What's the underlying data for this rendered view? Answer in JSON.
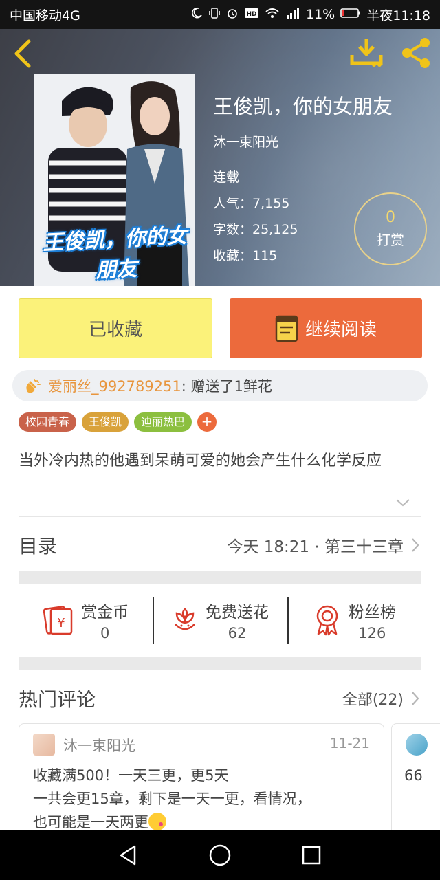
{
  "status_bar": {
    "carrier": "中国移动4G",
    "battery": "11%",
    "time": "半夜11:18",
    "icons": [
      "moon-icon",
      "vibrate-icon",
      "alarm-icon",
      "hd-icon",
      "wifi-icon",
      "signal-icon",
      "battery-icon"
    ]
  },
  "header": {
    "cover_title": "王俊凯，你的女朋友",
    "title": "王俊凯，你的女朋友",
    "author": "沐一束阳光",
    "status": "连载",
    "popularity": "人气：7,155",
    "word_count": "字数：25,125",
    "favorites": "收藏：115",
    "tip_count": "0",
    "tip_label": "打赏",
    "accent_color": "#f0c419"
  },
  "actions": {
    "favorited_label": "已收藏",
    "read_label": "继续阅读",
    "favorited_color": "#fbf27a",
    "read_color": "#ec6a3c"
  },
  "gift": {
    "user": "爱丽丝_992789251",
    "text": ":  赠送了1鲜花"
  },
  "tags": [
    {
      "label": "校园青春",
      "color": "#c9624a"
    },
    {
      "label": "王俊凯",
      "color": "#d9a23a"
    },
    {
      "label": "迪丽热巴",
      "color": "#8cbf3f"
    }
  ],
  "description": "当外冷内热的他遇到呆萌可爱的她会产生什么化学反应",
  "toc": {
    "title": "目录",
    "latest": "今天 18:21 · 第三十三章"
  },
  "stats": [
    {
      "label": "赏金币",
      "value": "0",
      "icon": "red-envelope-icon"
    },
    {
      "label": "免费送花",
      "value": "62",
      "icon": "flower-icon"
    },
    {
      "label": "粉丝榜",
      "value": "126",
      "icon": "medal-icon"
    }
  ],
  "comments": {
    "title": "热门评论",
    "all_label": "全部(22)",
    "items": [
      {
        "user": "沐一束阳光",
        "date": "11-21",
        "text": "收藏满500！一天三更，更5天\n一共会更15章，剩下是一天一更，看情况，\n也可能是一天两更"
      },
      {
        "text": "66"
      }
    ]
  }
}
